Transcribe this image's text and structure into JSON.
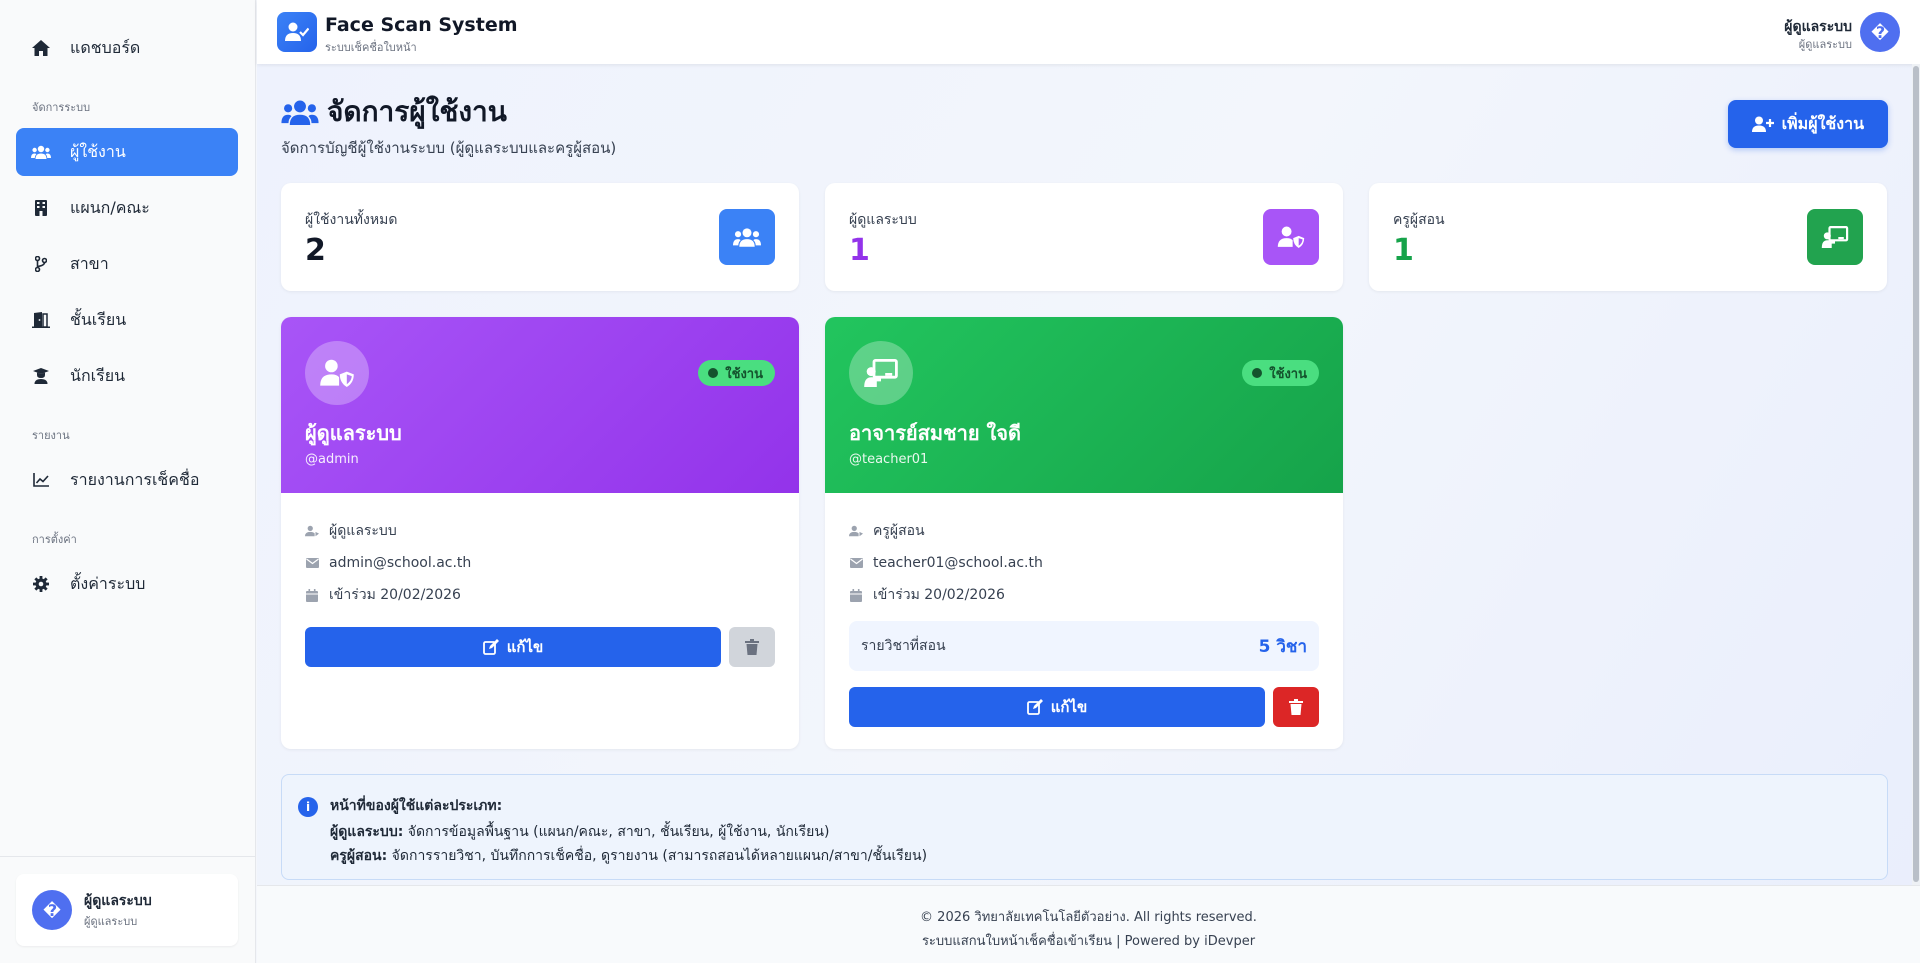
{
  "sidebar": {
    "dashboard": "แดชบอร์ด",
    "section_manage": "จัดการระบบ",
    "users": "ผู้ใช้งาน",
    "departments": "แผนก/คณะ",
    "branches": "สาขา",
    "classes": "ชั้นเรียน",
    "students": "นักเรียน",
    "section_reports": "รายงาน",
    "attendance_report": "รายงานการเช็คชื่อ",
    "section_settings": "การตั้งค่า",
    "system_settings": "ตั้งค่าระบบ",
    "user_name": "ผู้ดูแลระบบ",
    "user_role": "ผู้ดูแลระบบ",
    "avatar_glyph": "�"
  },
  "header": {
    "title": "Face Scan System",
    "subtitle": "ระบบเช็คชื่อใบหน้า",
    "user_name": "ผู้ดูแลระบบ",
    "user_role": "ผู้ดูแลระบบ",
    "avatar_glyph": "�"
  },
  "page": {
    "title": "จัดการผู้ใช้งาน",
    "subtitle": "จัดการบัญชีผู้ใช้งานระบบ (ผู้ดูแลระบบและครูผู้สอน)",
    "add_button": "เพิ่มผู้ใช้งาน"
  },
  "stats": [
    {
      "label": "ผู้ใช้งานทั้งหมด",
      "value": "2",
      "color": "#111827",
      "icon": "users-icon",
      "icon_bg": "#3b82f6"
    },
    {
      "label": "ผู้ดูแลระบบ",
      "value": "1",
      "color": "#9333ea",
      "icon": "user-shield-icon",
      "icon_bg": "#a855f7"
    },
    {
      "label": "ครูผู้สอน",
      "value": "1",
      "color": "#16a34a",
      "icon": "chalkboard-teacher-icon",
      "icon_bg": "#22a34f"
    }
  ],
  "users": [
    {
      "name": "ผู้ดูแลระบบ",
      "handle": "@admin",
      "status": "ใช้งาน",
      "role": "ผู้ดูแลระบบ",
      "email": "admin@school.ac.th",
      "joined": "เข้าร่วม 20/02/2026",
      "edit_label": "แก้ไข",
      "delete_disabled": true
    },
    {
      "name": "อาจารย์สมชาย ใจดี",
      "handle": "@teacher01",
      "status": "ใช้งาน",
      "role": "ครูผู้สอน",
      "email": "teacher01@school.ac.th",
      "joined": "เข้าร่วม 20/02/2026",
      "subjects_label": "รายวิชาที่สอน",
      "subjects_value": "5 วิชา",
      "edit_label": "แก้ไข",
      "delete_disabled": false
    }
  ],
  "info": {
    "title": "หน้าที่ของผู้ใช้แต่ละประเภท:",
    "admin_label": "ผู้ดูแลระบบ:",
    "admin_text": " จัดการข้อมูลพื้นฐาน (แผนก/คณะ, สาขา, ชั้นเรียน, ผู้ใช้งาน, นักเรียน)",
    "teacher_label": "ครูผู้สอน:",
    "teacher_text": " จัดการรายวิชา, บันทึกการเช็คชื่อ, ดูรายงาน (สามารถสอนได้หลายแผนก/สาขา/ชั้นเรียน)"
  },
  "footer": {
    "line1": "© 2026 วิทยาลัยเทคโนโลยีตัวอย่าง. All rights reserved.",
    "line2": "ระบบแสกนใบหน้าเช็คชื่อเข้าเรียน | Powered by iDevper"
  },
  "colors": {
    "primary": "#2563eb",
    "admin_gradient": [
      "#a855f7",
      "#9333ea"
    ],
    "teacher_gradient": [
      "#22c55e",
      "#16a34a"
    ],
    "danger": "#dc2626"
  }
}
